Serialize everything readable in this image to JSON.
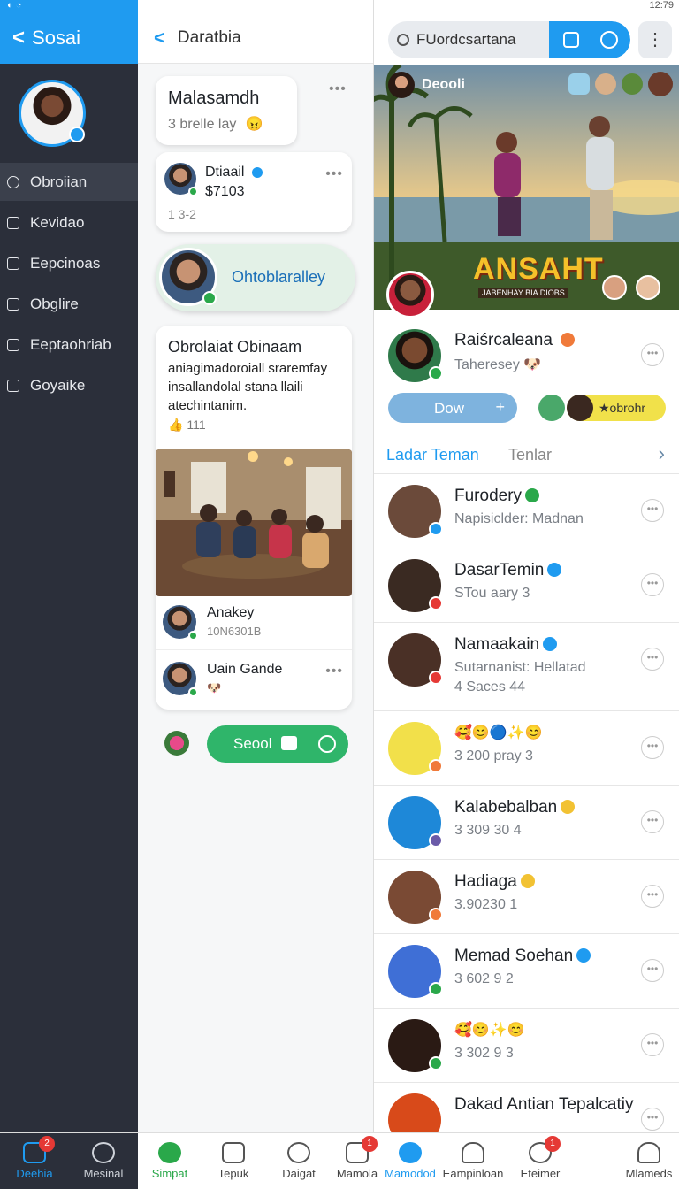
{
  "status": {
    "left": "◐ ◔",
    "right": "12:79"
  },
  "sidebar": {
    "title": "Sosai",
    "items": [
      {
        "label": "Obroiian"
      },
      {
        "label": "Kevidao"
      },
      {
        "label": "Eepcinoas"
      },
      {
        "label": "Obglire"
      },
      {
        "label": "Eeptaohriab"
      },
      {
        "label": "Goyaike"
      }
    ]
  },
  "middle": {
    "title": "Daratbia",
    "bubble": {
      "title": "Malasamdh",
      "subtitle": "3 brelle lay",
      "emoji": "😠"
    },
    "profile_card": {
      "name": "Dtiaail",
      "amount": "$7103",
      "meta": "1 3-2"
    },
    "pill_name": "Ohtoblaralley",
    "post": {
      "title": "Obrolaiat Obinaam",
      "body": "aniagimadoroiall sraremfay insallandolal stana llaili atechintanim.",
      "reactions": "👍 111",
      "comment1_name": "Anakey",
      "comment1_meta": "10N6301B",
      "comment2_name": "Uain Gande",
      "comment2_emoji": "🐶"
    },
    "send_button": "Seool"
  },
  "right": {
    "search_placeholder": "FUordcsartana",
    "hero": {
      "tag": "Deooli",
      "title": "ANSAHT",
      "subtitle": "JABENHAY BIA DIOBS"
    },
    "feature": {
      "name": "Raiśrcaleana",
      "sub": "Taheresey 🐶"
    },
    "action_button": "Dow",
    "action_plus": "+",
    "chip_label": "★obrohr",
    "tabs": {
      "active": "Ladar Teman",
      "inactive": "Tenlar"
    },
    "friends": [
      {
        "name": "Furodery",
        "sub": "Napisiclder: Madnan",
        "badge": "#2aa84a",
        "avatar": "#6b4a3a"
      },
      {
        "name": "DasarTemin",
        "sub": "STou aary 3",
        "badge": "#1f9bf0",
        "avatar": "#3a2a22"
      },
      {
        "name": "Namaakain",
        "sub": "Sutarnanist: Hellatad",
        "sub2": "4 Saces 44",
        "badge": "#1f9bf0",
        "avatar": "#4a3026"
      },
      {
        "name": "",
        "sub": "3 200 pray 3",
        "emojis": "🥰😊🔵✨😊",
        "badge": "",
        "avatar": "#f2e04a"
      },
      {
        "name": "Kalabebalban",
        "sub": "3 309 30 4",
        "badge": "#f2c233",
        "avatar": "#1e88d8"
      },
      {
        "name": "Hadiaga",
        "sub": "3.90230 1",
        "badge": "#f2c233",
        "avatar": "#7a4a34"
      },
      {
        "name": "Memad Soehan",
        "sub": "3 602 9 2",
        "badge": "#1f9bf0",
        "avatar": "#3f6fd6"
      },
      {
        "name": "",
        "sub": "3 302 9 3",
        "emojis": "🥰😊✨😊",
        "badge": "",
        "avatar": "#2a1a14"
      },
      {
        "name": "Dakad Antian Tepalcatiy",
        "sub": "",
        "badge": "",
        "avatar": "#d84a1a"
      }
    ]
  },
  "bottom_nav": [
    {
      "label": "Deehia",
      "badge": "2"
    },
    {
      "label": "Mesinal",
      "badge": ""
    },
    {
      "label": "Simpat",
      "badge": ""
    },
    {
      "label": "Tepuk",
      "badge": ""
    },
    {
      "label": "Daigat",
      "badge": ""
    },
    {
      "label": "Mamola",
      "badge": "1"
    },
    {
      "label": "Mamodod",
      "badge": ""
    },
    {
      "label": "Eampinloan",
      "badge": ""
    },
    {
      "label": "Eteimer",
      "badge": "1"
    },
    {
      "label": "Mlameds",
      "badge": ""
    }
  ]
}
